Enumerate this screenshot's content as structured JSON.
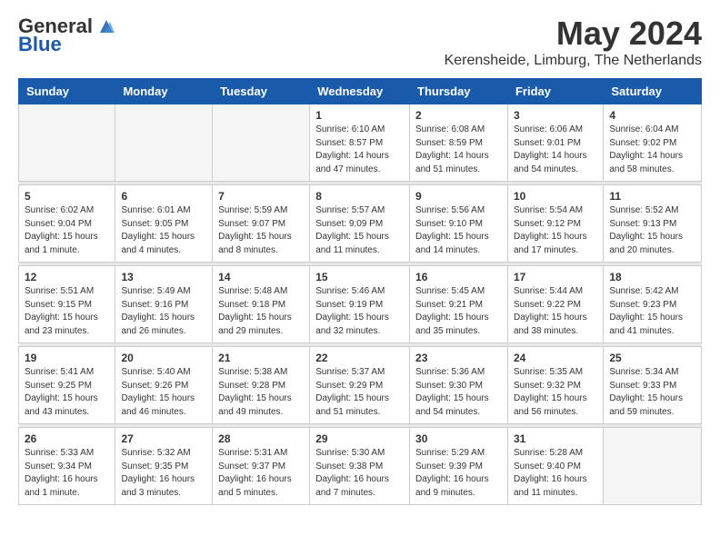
{
  "header": {
    "logo_general": "General",
    "logo_blue": "Blue",
    "month_title": "May 2024",
    "location": "Kerensheide, Limburg, The Netherlands"
  },
  "days_of_week": [
    "Sunday",
    "Monday",
    "Tuesday",
    "Wednesday",
    "Thursday",
    "Friday",
    "Saturday"
  ],
  "weeks": [
    [
      {
        "day": "",
        "info": ""
      },
      {
        "day": "",
        "info": ""
      },
      {
        "day": "",
        "info": ""
      },
      {
        "day": "1",
        "info": "Sunrise: 6:10 AM\nSunset: 8:57 PM\nDaylight: 14 hours and 47 minutes."
      },
      {
        "day": "2",
        "info": "Sunrise: 6:08 AM\nSunset: 8:59 PM\nDaylight: 14 hours and 51 minutes."
      },
      {
        "day": "3",
        "info": "Sunrise: 6:06 AM\nSunset: 9:01 PM\nDaylight: 14 hours and 54 minutes."
      },
      {
        "day": "4",
        "info": "Sunrise: 6:04 AM\nSunset: 9:02 PM\nDaylight: 14 hours and 58 minutes."
      }
    ],
    [
      {
        "day": "5",
        "info": "Sunrise: 6:02 AM\nSunset: 9:04 PM\nDaylight: 15 hours and 1 minute."
      },
      {
        "day": "6",
        "info": "Sunrise: 6:01 AM\nSunset: 9:05 PM\nDaylight: 15 hours and 4 minutes."
      },
      {
        "day": "7",
        "info": "Sunrise: 5:59 AM\nSunset: 9:07 PM\nDaylight: 15 hours and 8 minutes."
      },
      {
        "day": "8",
        "info": "Sunrise: 5:57 AM\nSunset: 9:09 PM\nDaylight: 15 hours and 11 minutes."
      },
      {
        "day": "9",
        "info": "Sunrise: 5:56 AM\nSunset: 9:10 PM\nDaylight: 15 hours and 14 minutes."
      },
      {
        "day": "10",
        "info": "Sunrise: 5:54 AM\nSunset: 9:12 PM\nDaylight: 15 hours and 17 minutes."
      },
      {
        "day": "11",
        "info": "Sunrise: 5:52 AM\nSunset: 9:13 PM\nDaylight: 15 hours and 20 minutes."
      }
    ],
    [
      {
        "day": "12",
        "info": "Sunrise: 5:51 AM\nSunset: 9:15 PM\nDaylight: 15 hours and 23 minutes."
      },
      {
        "day": "13",
        "info": "Sunrise: 5:49 AM\nSunset: 9:16 PM\nDaylight: 15 hours and 26 minutes."
      },
      {
        "day": "14",
        "info": "Sunrise: 5:48 AM\nSunset: 9:18 PM\nDaylight: 15 hours and 29 minutes."
      },
      {
        "day": "15",
        "info": "Sunrise: 5:46 AM\nSunset: 9:19 PM\nDaylight: 15 hours and 32 minutes."
      },
      {
        "day": "16",
        "info": "Sunrise: 5:45 AM\nSunset: 9:21 PM\nDaylight: 15 hours and 35 minutes."
      },
      {
        "day": "17",
        "info": "Sunrise: 5:44 AM\nSunset: 9:22 PM\nDaylight: 15 hours and 38 minutes."
      },
      {
        "day": "18",
        "info": "Sunrise: 5:42 AM\nSunset: 9:23 PM\nDaylight: 15 hours and 41 minutes."
      }
    ],
    [
      {
        "day": "19",
        "info": "Sunrise: 5:41 AM\nSunset: 9:25 PM\nDaylight: 15 hours and 43 minutes."
      },
      {
        "day": "20",
        "info": "Sunrise: 5:40 AM\nSunset: 9:26 PM\nDaylight: 15 hours and 46 minutes."
      },
      {
        "day": "21",
        "info": "Sunrise: 5:38 AM\nSunset: 9:28 PM\nDaylight: 15 hours and 49 minutes."
      },
      {
        "day": "22",
        "info": "Sunrise: 5:37 AM\nSunset: 9:29 PM\nDaylight: 15 hours and 51 minutes."
      },
      {
        "day": "23",
        "info": "Sunrise: 5:36 AM\nSunset: 9:30 PM\nDaylight: 15 hours and 54 minutes."
      },
      {
        "day": "24",
        "info": "Sunrise: 5:35 AM\nSunset: 9:32 PM\nDaylight: 15 hours and 56 minutes."
      },
      {
        "day": "25",
        "info": "Sunrise: 5:34 AM\nSunset: 9:33 PM\nDaylight: 15 hours and 59 minutes."
      }
    ],
    [
      {
        "day": "26",
        "info": "Sunrise: 5:33 AM\nSunset: 9:34 PM\nDaylight: 16 hours and 1 minute."
      },
      {
        "day": "27",
        "info": "Sunrise: 5:32 AM\nSunset: 9:35 PM\nDaylight: 16 hours and 3 minutes."
      },
      {
        "day": "28",
        "info": "Sunrise: 5:31 AM\nSunset: 9:37 PM\nDaylight: 16 hours and 5 minutes."
      },
      {
        "day": "29",
        "info": "Sunrise: 5:30 AM\nSunset: 9:38 PM\nDaylight: 16 hours and 7 minutes."
      },
      {
        "day": "30",
        "info": "Sunrise: 5:29 AM\nSunset: 9:39 PM\nDaylight: 16 hours and 9 minutes."
      },
      {
        "day": "31",
        "info": "Sunrise: 5:28 AM\nSunset: 9:40 PM\nDaylight: 16 hours and 11 minutes."
      },
      {
        "day": "",
        "info": ""
      }
    ]
  ]
}
